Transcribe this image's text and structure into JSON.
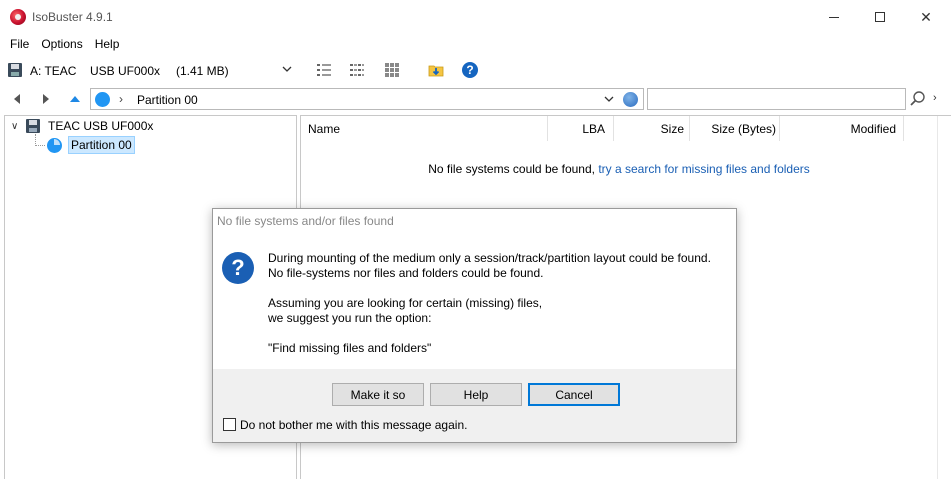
{
  "window": {
    "title": "IsoBuster 4.9.1",
    "controls": {
      "minimize": "minimize",
      "maximize": "maximize",
      "close": "✕"
    }
  },
  "menu": [
    "File",
    "Options",
    "Help"
  ],
  "toolbar": {
    "drive_letter": "A: TEAC",
    "drive_name": "USB UF000x",
    "drive_size": "(1.41 MB)",
    "help_icon": "?"
  },
  "navigation": {
    "path_chevron": "›",
    "path": "Partition 00",
    "search_more": "›"
  },
  "tree": {
    "device": {
      "expander": "∨",
      "label": "TEAC USB UF000x"
    },
    "partition": {
      "label": "Partition 00"
    }
  },
  "file_list": {
    "columns": [
      "Name",
      "LBA",
      "Size",
      "Size (Bytes)",
      "Modified"
    ],
    "message": "No file systems could be found, ",
    "link": "try a search for missing files and folders"
  },
  "dialog": {
    "title": "No file systems and/or files found",
    "icon": "?",
    "lines": [
      "During mounting of the medium only a session/track/partition layout could be found.",
      "No file-systems nor files and folders could be found.",
      "",
      "Assuming you are looking for certain (missing) files,",
      "we suggest you run the option:",
      "",
      "\"Find missing files and folders\""
    ],
    "buttons": {
      "make_it_so": "Make it so",
      "help": "Help",
      "cancel": "Cancel"
    },
    "checkbox_label": "Do not bother me with this message again.",
    "checkbox_checked": false
  },
  "colors": {
    "accent": "#0078d7",
    "link": "#1a5fb4",
    "selection": "#cce8ff",
    "icon_blue": "#2196f3"
  }
}
